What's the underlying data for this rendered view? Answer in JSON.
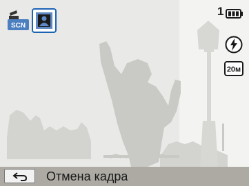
{
  "status": {
    "shot_count": "1",
    "scene_mode_icon": "scene-mode-icon",
    "scene_mode_text": "SCN",
    "backlight_icon": "backlight-portrait-icon",
    "battery_icon": "battery-full-icon",
    "flash_icon": "flash-auto-icon",
    "resolution_icon": "resolution-20m-icon",
    "resolution_text": "20м"
  },
  "bottom_bar": {
    "back_icon": "back-arrow-icon",
    "label": "Отмена кадра"
  },
  "colors": {
    "overlay": "#e9e9e7",
    "silhouette": "#c9c9c6",
    "bar": "#acaaa3"
  }
}
